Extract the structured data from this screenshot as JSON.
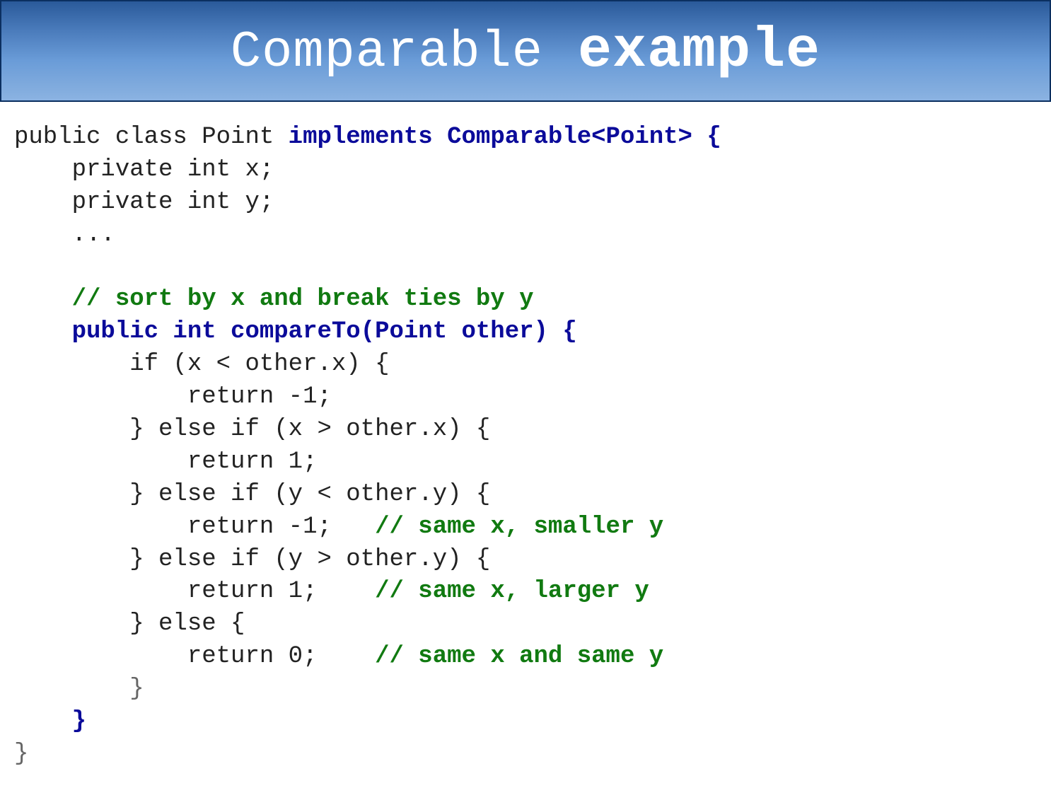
{
  "title": {
    "part1": "Comparable",
    "part2": " example"
  },
  "code": {
    "line1_a": "public class Point ",
    "line1_b": "implements Comparable<Point> {",
    "line2": "    private int x;",
    "line3": "    private int y;",
    "line4": "    ...",
    "line5": "",
    "line6": "    // sort by x and break ties by y",
    "line7": "    public int compareTo(Point other) {",
    "line8": "        if (x < other.x) {",
    "line9": "            return -1;",
    "line10": "        } else if (x > other.x) {",
    "line11": "            return 1;",
    "line12": "        } else if (y < other.y) {",
    "line13_a": "            return -1;   ",
    "line13_b": "// same x, smaller y",
    "line14": "        } else if (y > other.y) {",
    "line15_a": "            return 1;    ",
    "line15_b": "// same x, larger y",
    "line16": "        } else {",
    "line17_a": "            return 0;    ",
    "line17_b": "// same x and same y",
    "line18": "        }",
    "line19": "    }",
    "line20": "}"
  }
}
